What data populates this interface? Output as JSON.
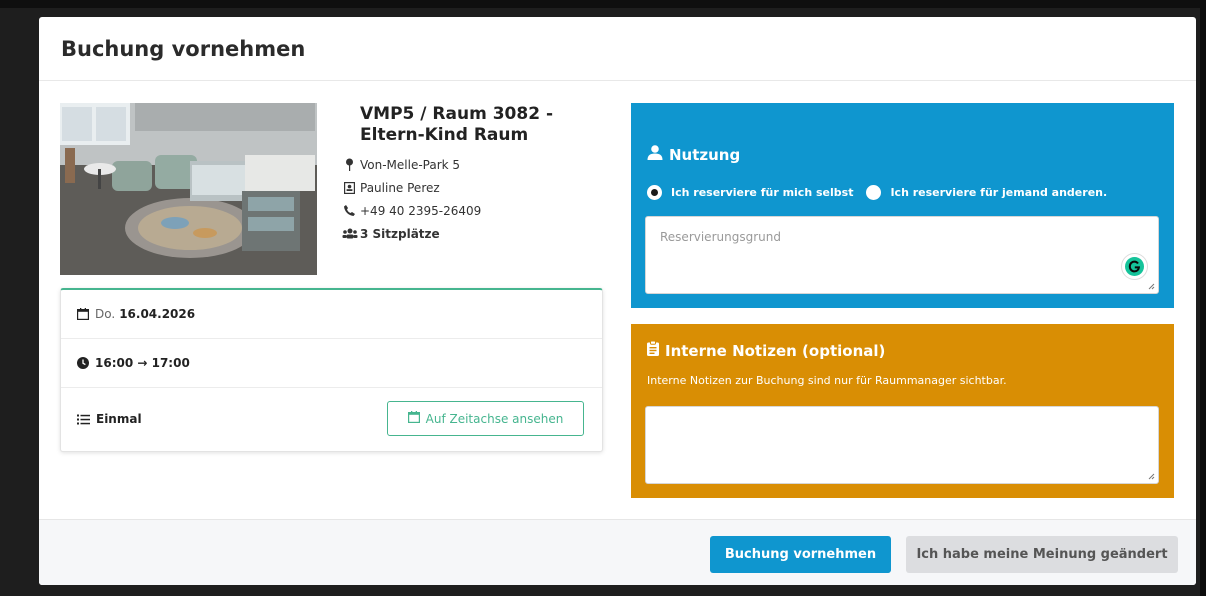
{
  "modal": {
    "title": "Buchung vornehmen"
  },
  "room": {
    "name": "VMP5 / Raum 3082 - Eltern-Kind Raum",
    "address": "Von-Melle-Park 5",
    "contact": "Pauline Perez",
    "phone": "+49 40 2395-26409",
    "seats": "3 Sitzplätze"
  },
  "booking": {
    "day_of_week": "Do.",
    "date": "16.04.2026",
    "time": "16:00 → 17:00",
    "recurrence": "Einmal",
    "timeline_button": "Auf Zeitachse ansehen"
  },
  "usage": {
    "heading": "Nutzung",
    "radio_self": "Ich reserviere für mich selbst",
    "radio_other": "Ich reserviere für jemand anderen.",
    "selected": "self",
    "reason_placeholder": "Reservierungsgrund"
  },
  "notes": {
    "heading": "Interne Notizen (optional)",
    "info": "Interne Notizen zur Buchung sind nur für Raummanager sichtbar.",
    "value": ""
  },
  "footer": {
    "confirm_label": "Buchung vornehmen",
    "cancel_label": "Ich habe meine Meinung geändert"
  },
  "colors": {
    "accent_blue": "#0f96cf",
    "accent_orange": "#d98e04",
    "accent_green": "#46b58f"
  }
}
